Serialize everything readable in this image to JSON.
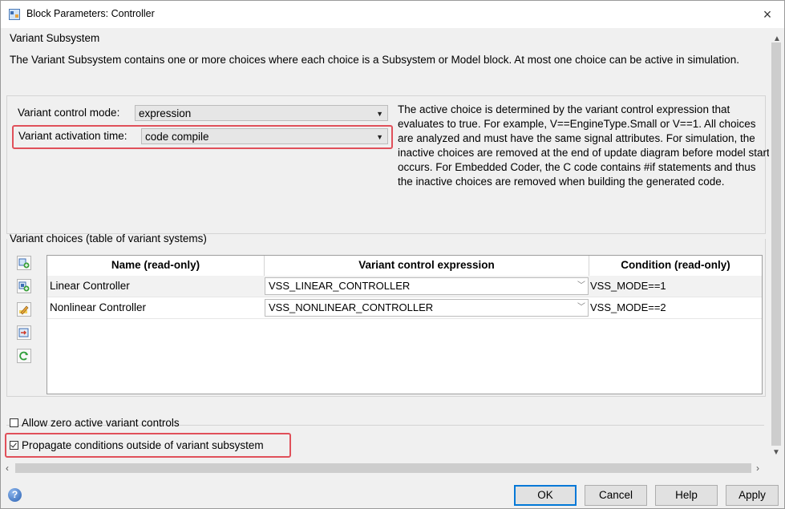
{
  "window": {
    "title": "Block Parameters: Controller",
    "close_label": "×"
  },
  "section_title": "Variant Subsystem",
  "description": "The Variant Subsystem contains one or more choices where each choice is a Subsystem or Model block. At most one choice can be active in simulation.",
  "control_mode": {
    "label": "Variant control mode:",
    "value": "expression"
  },
  "activation_time": {
    "label": "Variant activation time:",
    "value": "code compile"
  },
  "help_text": "The active choice is determined by the variant control expression that evaluates to true. For example, V==EngineType.Small or V==1. All choices are analyzed and must have the same signal attributes. For simulation, the inactive choices are removed at the end of update diagram before model start occurs. For Embedded Coder,  the C code contains #if statements and thus the inactive choices are removed when building the generated code.",
  "variant_choices": {
    "label": "Variant choices (table of variant systems)",
    "columns": [
      "Name (read-only)",
      "Variant control expression",
      "Condition (read-only)"
    ],
    "rows": [
      {
        "name": "Linear Controller",
        "expression": "VSS_LINEAR_CONTROLLER",
        "condition": "VSS_MODE==1"
      },
      {
        "name": "Nonlinear Controller",
        "expression": "VSS_NONLINEAR_CONTROLLER",
        "condition": "VSS_MODE==2"
      }
    ],
    "toolbar_icons": [
      "add-subsystem-choice-icon",
      "add-model-choice-icon",
      "edit-choice-icon",
      "open-choice-icon",
      "refresh-icon"
    ]
  },
  "options": {
    "allow_zero": {
      "label": "Allow zero active variant controls",
      "checked": false
    },
    "propagate": {
      "label": "Propagate conditions outside of variant subsystem",
      "checked": true
    }
  },
  "buttons": {
    "ok": "OK",
    "cancel": "Cancel",
    "help": "Help",
    "apply": "Apply"
  },
  "colors": {
    "highlight_box": "#e0505a",
    "default_button_border": "#0078d7"
  }
}
